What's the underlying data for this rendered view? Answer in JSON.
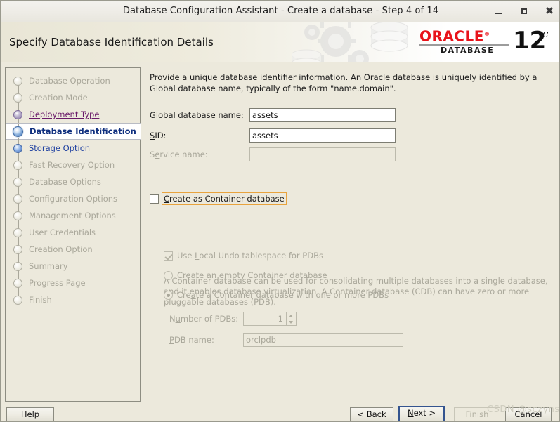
{
  "window": {
    "title": "Database Configuration Assistant - Create a database - Step 4 of 14",
    "minimize_icon": "minimize-icon",
    "maximize_icon": "maximize-icon",
    "close_icon": "close-icon"
  },
  "banner": {
    "heading": "Specify Database Identification Details",
    "logo_brand": "ORACLE",
    "logo_registered": "®",
    "logo_product": "DATABASE",
    "logo_version": "12",
    "logo_version_suffix": "c"
  },
  "sidebar": {
    "items": [
      {
        "label": "Database Operation",
        "state": "pending"
      },
      {
        "label": "Creation Mode",
        "state": "pending"
      },
      {
        "label": "Deployment Type",
        "state": "visited"
      },
      {
        "label": "Database Identification",
        "state": "current"
      },
      {
        "label": "Storage Option",
        "state": "done"
      },
      {
        "label": "Fast Recovery Option",
        "state": "pending"
      },
      {
        "label": "Database Options",
        "state": "pending"
      },
      {
        "label": "Configuration Options",
        "state": "pending"
      },
      {
        "label": "Management Options",
        "state": "pending"
      },
      {
        "label": "User Credentials",
        "state": "pending"
      },
      {
        "label": "Creation Option",
        "state": "pending"
      },
      {
        "label": "Summary",
        "state": "pending"
      },
      {
        "label": "Progress Page",
        "state": "pending"
      },
      {
        "label": "Finish",
        "state": "pending"
      }
    ]
  },
  "main": {
    "intro": "Provide a unique database identifier information. An Oracle database is uniquely identified by a Global database name, typically of the form \"name.domain\".",
    "fields": {
      "global_db_name_label": "Global database name:",
      "global_db_name_value": "assets",
      "sid_label": "SID:",
      "sid_value": "assets",
      "service_name_label": "Service name:",
      "service_name_value": ""
    },
    "container": {
      "checkbox_label": "Create as Container database",
      "checkbox_checked": false,
      "description": "A Container database can be used for consolidating multiple databases into a single database, and it enables database virtualization. A Container database (CDB) can have zero or more pluggable databases (PDB).",
      "local_undo_label": "Use Local Undo tablespace for PDBs",
      "local_undo_checked": true,
      "radio_empty_label": "Create an empty Container database",
      "radio_with_pdbs_label": "Create a Container database with one or more PDBs",
      "radio_selected": "with_pdbs",
      "num_pdbs_label": "Number of PDBs:",
      "num_pdbs_value": "1",
      "pdb_name_label": "PDB name:",
      "pdb_name_value": "orclpdb"
    }
  },
  "footer": {
    "help": "Help",
    "back": "< Back",
    "next": "Next >",
    "finish": "Finish",
    "cancel": "Cancel"
  },
  "watermark": "CSDN @sczyns",
  "colors": {
    "window_bg": "#ece9dc",
    "accent_blue": "#10307f",
    "link_purple": "#6a1a6a",
    "link_blue": "#1d3fa0",
    "oracle_red": "#e8131a",
    "focus_orange": "#e8a33d",
    "disabled_text": "#a9a79a"
  }
}
